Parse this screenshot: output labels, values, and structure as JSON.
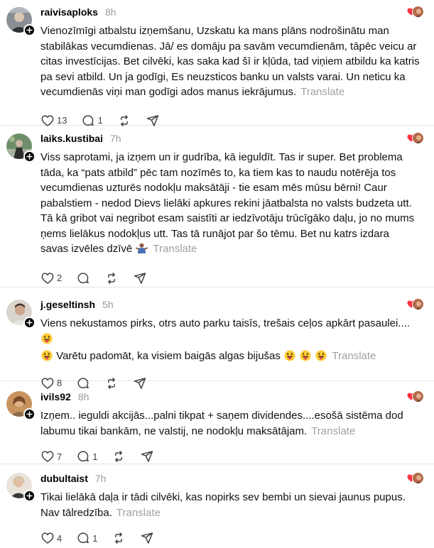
{
  "posts": [
    {
      "username": "raivisaploks",
      "time": "8h",
      "text": "Vienozīmīgi atbalstu izņemšanu, Uzskatu ka mans plāns nodrošinātu man stabilākas vecumdienas. Jā/ es domāju pa savām vecumdienām, tāpēc veicu ar citas investīcijas. Bet cilvēki, kas saka kad šī ir kļūda, tad viņiem atbildu ka katris pa sevi atbild. Un ja godīgi, Es neuzsticos banku un valsts varai. Un neticu ka vecumdienās viņi man godīgi ados manus iekrājumus.",
      "translate": "Translate",
      "likes": "13",
      "replies": "1"
    },
    {
      "username": "laiks.kustibai",
      "time": "7h",
      "text": "Viss saprotami, ja izņem un ir gudrība, kā ieguldīt. Tas ir super. Bet problema tāda, ka “pats atbild” pēc tam nozīmēs to, ka tiem kas to naudu notērēja tos vecumdienas uzturēs nodokļu maksātāji - tie esam mēs mūsu bērni! Caur pabalstiem - nedod Dievs lielāki apkures rekini jāatbalsta no valsts budzeta utt. Tā kā gribot vai negribot esam saistīti ar iedzīvotāju trūcīgāko daļu, jo no mums ņems lielākus nodokļus utt. Tas tā runājot par šo tēmu. Bet nu katrs izdara savas izvēles dzīvē",
      "emoji": "person-shrugging-emoji",
      "translate": "Translate",
      "likes": "2",
      "replies": ""
    },
    {
      "username": "j.geseltinsh",
      "time": "5h",
      "text_a": "Viens nekustamos pirks, otrs auto parku taisīs, trešais ceļos apkārt pasaulei....",
      "text_b": "Varētu padomāt, ka visiem baigās algas bijušas",
      "emoji": "grinning-tongue-emoji",
      "translate": "Translate",
      "likes": "8",
      "replies": ""
    },
    {
      "username": "ivils92",
      "time": "8h",
      "text": "Izņem.. ieguldi akcijās...palni tikpat + saņem dividendes....esošā sistēma dod labumu tikai bankām, ne valstij, ne nodokļu maksātājam.",
      "translate": "Translate",
      "likes": "7",
      "replies": "1"
    },
    {
      "username": "dubultaist",
      "time": "7h",
      "text": "Tikai lielākā daļa ir tādi cilvēki, kas nopirks sev bembi un sievai jaunus pupus. Nav tālredzība.",
      "translate": "Translate",
      "likes": "4",
      "replies": "1"
    }
  ],
  "icons": [
    "heart-icon",
    "comment-icon",
    "repost-icon",
    "share-icon",
    "plus-icon",
    "liked-heart-icon"
  ],
  "colors": {
    "liked": "#ff3040",
    "muted": "#999999",
    "divider": "#e5e5e5"
  }
}
